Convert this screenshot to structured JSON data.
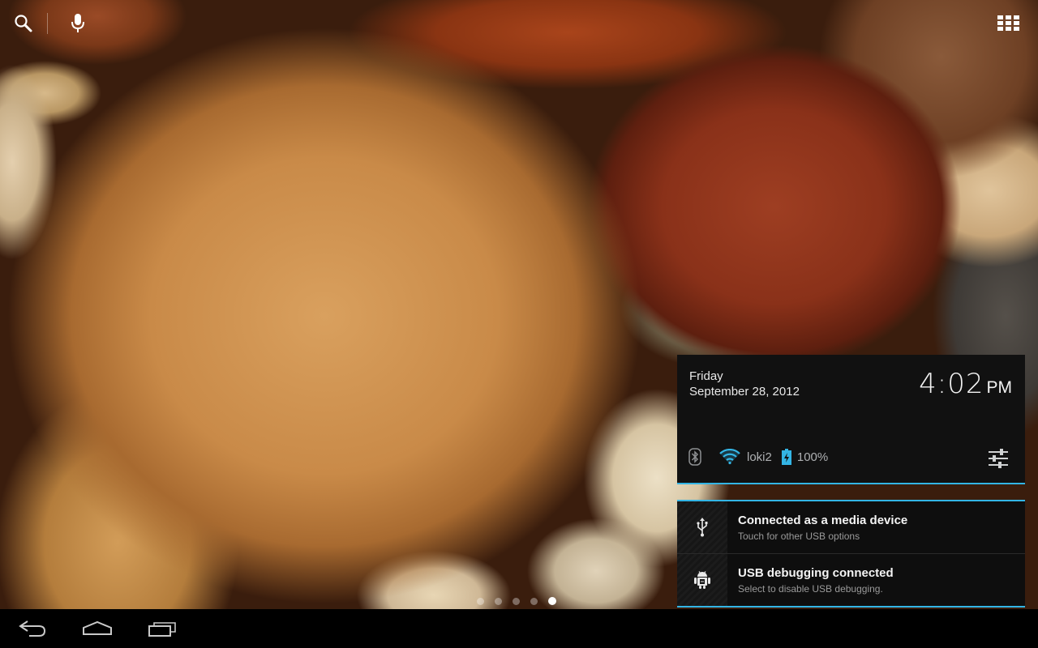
{
  "launcher": {
    "search_icon": "search-icon",
    "voice_icon": "microphone-icon",
    "apps_icon": "all-apps-grid-icon",
    "pages": [
      false,
      false,
      false,
      false,
      true
    ]
  },
  "notification_panel": {
    "day": "Friday",
    "date": "September 28, 2012",
    "time": "4:02",
    "ampm": "PM",
    "wifi_name": "loki2",
    "battery": "100%",
    "notifications": [
      {
        "title": "Connected as a media device",
        "subtitle": "Touch for other USB options",
        "icon": "usb-icon"
      },
      {
        "title": "USB debugging connected",
        "subtitle": "Select to disable USB debugging.",
        "icon": "android-debug-icon"
      }
    ]
  },
  "navbar": {
    "back_icon": "back-icon",
    "home_icon": "home-icon",
    "recents_icon": "recent-apps-icon"
  },
  "colors": {
    "accent": "#33b5e5",
    "panel_bg": "#111111"
  }
}
